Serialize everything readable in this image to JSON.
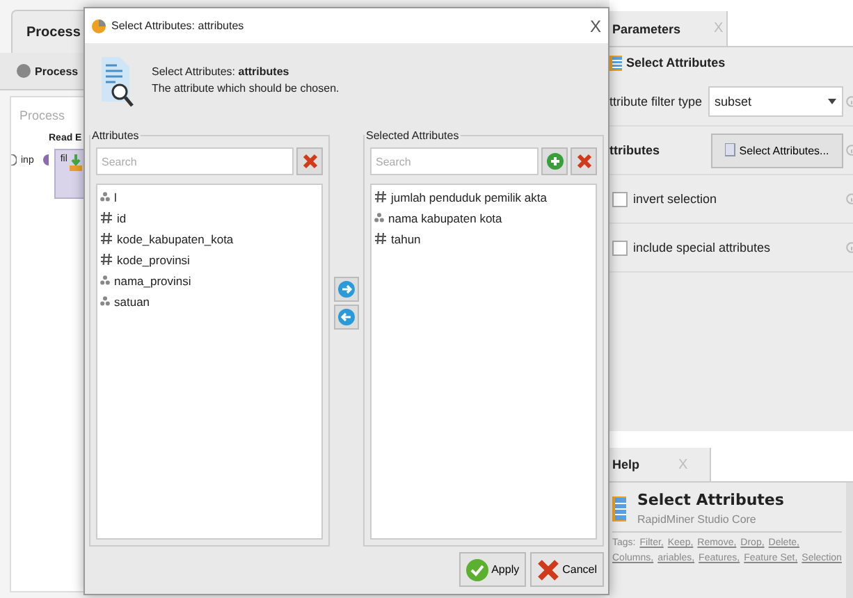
{
  "process_panel": {
    "tab": "Process",
    "breadcrumb": "Process",
    "canvas_label": "Process",
    "operator": {
      "name": "Read E",
      "in_port": "inp",
      "out_port": "fil"
    }
  },
  "parameters_panel": {
    "tab": "Parameters",
    "close": "X",
    "operator": "Select Attributes",
    "params": [
      {
        "kind": "select",
        "label": "ttribute filter type",
        "value": "subset"
      },
      {
        "kind": "button",
        "label": "ttributes",
        "button": "Select Attributes..."
      },
      {
        "kind": "checkbox",
        "label": "invert selection",
        "checked": false
      },
      {
        "kind": "checkbox",
        "label": "include special attributes",
        "checked": false
      }
    ]
  },
  "help_panel": {
    "tab": "Help",
    "close": "X",
    "title": "Select Attributes",
    "subtitle": "RapidMiner Studio Core",
    "tags_label": "Tags:",
    "tags": [
      "Filter,",
      "Keep,",
      "Remove,",
      "Drop,",
      "Delete,",
      "Columns,",
      "ariables,",
      "Features,",
      "Feature Set,",
      "Selection"
    ]
  },
  "dialog": {
    "title": "Select Attributes: attributes",
    "close": "X",
    "heading": "Select Attributes: **attributes**",
    "description": "The attribute which should be chosen.",
    "available": {
      "title": "Attributes",
      "placeholder": "Search",
      "items": [
        {
          "name": "l",
          "kind": "nominal"
        },
        {
          "name": "id",
          "kind": "numeric"
        },
        {
          "name": "kode_kabupaten_kota",
          "kind": "numeric"
        },
        {
          "name": "kode_provinsi",
          "kind": "numeric"
        },
        {
          "name": "nama_provinsi",
          "kind": "nominal"
        },
        {
          "name": "satuan",
          "kind": "nominal"
        }
      ]
    },
    "selected": {
      "title": "Selected Attributes",
      "placeholder": "Search",
      "items": [
        {
          "name": "jumlah penduduk pemilik akta",
          "kind": "numeric"
        },
        {
          "name": "nama kabupaten kota",
          "kind": "nominal"
        },
        {
          "name": "tahun",
          "kind": "numeric"
        }
      ]
    },
    "buttons": [
      {
        "kind": "apply",
        "label": "Apply"
      },
      {
        "kind": "cancel",
        "label": "Cancel"
      }
    ]
  }
}
